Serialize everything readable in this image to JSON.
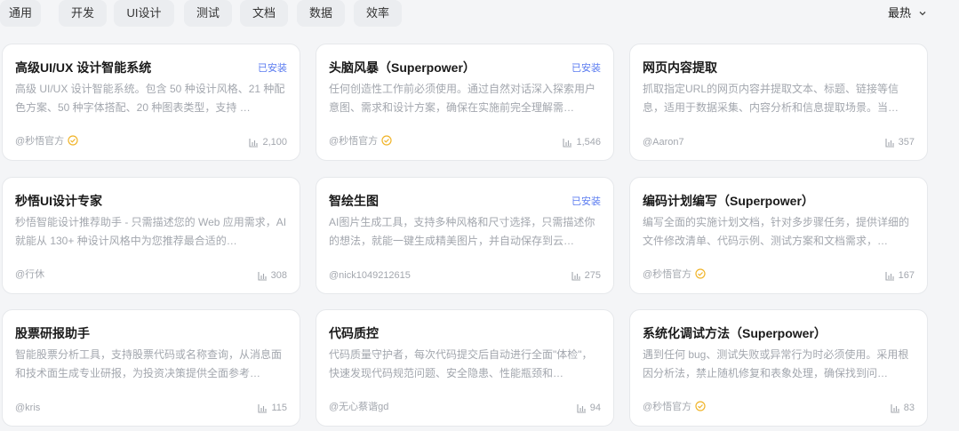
{
  "filters": [
    "通用",
    "开发",
    "UI设计",
    "测试",
    "文档",
    "数据",
    "效率"
  ],
  "sort": {
    "label": "最热"
  },
  "colors": {
    "accent": "#5b7cf0",
    "verified": "#f0b429",
    "muted": "#a3a7ae"
  },
  "cards": [
    {
      "title": "高级UI/UX 设计智能系统",
      "badge": "已安装",
      "desc": "高级 UI/UX 设计智能系统。包含 50 种设计风格、21 种配色方案、50 种字体搭配、20 种图表类型，支持 …",
      "author": "@秒悟官方",
      "verified": true,
      "count": "2,100"
    },
    {
      "title": "头脑风暴（Superpower）",
      "badge": "已安装",
      "desc": "任何创造性工作前必须使用。通过自然对话深入探索用户意图、需求和设计方案，确保在实施前完全理解需…",
      "author": "@秒悟官方",
      "verified": true,
      "count": "1,546"
    },
    {
      "title": "网页内容提取",
      "badge": "",
      "desc": "抓取指定URL的网页内容并提取文本、标题、链接等信息，适用于数据采集、内容分析和信息提取场景。当…",
      "author": "@Aaron7",
      "verified": false,
      "count": "357"
    },
    {
      "title": "秒悟UI设计专家",
      "badge": "",
      "desc": "秒悟智能设计推荐助手 - 只需描述您的 Web 应用需求，AI 就能从 130+ 种设计风格中为您推荐最合适的…",
      "author": "@行休",
      "verified": false,
      "count": "308"
    },
    {
      "title": "智绘生图",
      "badge": "已安装",
      "desc": "AI图片生成工具，支持多种风格和尺寸选择，只需描述你的想法，就能一键生成精美图片，并自动保存到云…",
      "author": "@nick1049212615",
      "verified": false,
      "count": "275"
    },
    {
      "title": "编码计划编写（Superpower）",
      "badge": "",
      "desc": "编写全面的实施计划文档，针对多步骤任务，提供详细的文件修改清单、代码示例、测试方案和文档需求，…",
      "author": "@秒悟官方",
      "verified": true,
      "count": "167"
    },
    {
      "title": "股票研报助手",
      "badge": "",
      "desc": "智能股票分析工具，支持股票代码或名称查询，从消息面和技术面生成专业研报，为投资决策提供全面参考…",
      "author": "@kris",
      "verified": false,
      "count": "115"
    },
    {
      "title": "代码质控",
      "badge": "",
      "desc": "代码质量守护者，每次代码提交后自动进行全面\"体检\"，快速发现代码规范问题、安全隐患、性能瓶颈和…",
      "author": "@无心蔡谐gd",
      "verified": false,
      "count": "94"
    },
    {
      "title": "系统化调试方法（Superpower）",
      "badge": "",
      "desc": "遇到任何 bug、测试失败或异常行为时必须使用。采用根因分析法，禁止随机修复和表象处理，确保找到问…",
      "author": "@秒悟官方",
      "verified": true,
      "count": "83"
    }
  ]
}
